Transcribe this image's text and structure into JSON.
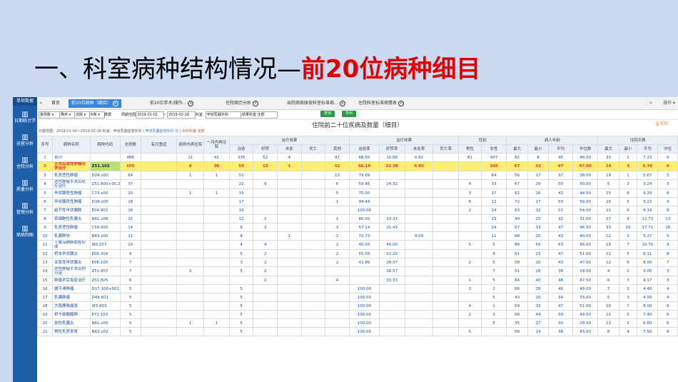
{
  "slide": {
    "title_prefix": "一、科室病种结构情况—",
    "title_highlight": "前20位病种细目"
  },
  "sidebar": {
    "brand": "单项数据",
    "items": [
      {
        "label": "日期统计学"
      },
      {
        "label": "运营分析"
      },
      {
        "label": "住院分析"
      },
      {
        "label": "质量分析"
      },
      {
        "label": "管理分析"
      },
      {
        "label": "病病制图"
      }
    ]
  },
  "tabs": {
    "back_icon": "«",
    "forward_icon": "»",
    "items": [
      {
        "label": "首页",
        "active": false
      },
      {
        "label": "前20位病种（细目）",
        "active": true
      },
      {
        "label": "前20位手术/操作...",
        "active": false
      },
      {
        "label": "住院病历分析",
        "active": false
      },
      {
        "label": "出院病病原按科室标准病...",
        "active": false
      },
      {
        "label": "住院科室标准病情表",
        "active": false
      }
    ],
    "ops": "操作 ▾"
  },
  "toolbar": {
    "sort": "各例数",
    "order": "降序",
    "metric": "出院",
    "rank": "N条",
    "unit": "数据",
    "date_label": "周期范围",
    "date_from": "2019-01-01",
    "date_to": "2019-02-28",
    "dept_label": "科室",
    "dept_value": "甲状乳腺外科",
    "group_value": "结果科室 全部",
    "search_btn": "查询",
    "export_btn": "导出"
  },
  "report": {
    "title": "住院前二十位疾病及数量（细目）",
    "print": "打印",
    "filter_prefix": "日期范围：2019-01-01～2019-02-28 科室：甲状乳腺血管外科 | ",
    "filter_hospital": "甲状乳腺血管外科 日",
    "filter_sep": " | ",
    "filter_group": "出科科室 全部"
  },
  "table": {
    "group_headers": [
      "治疗效果",
      "治疗效果",
      "性别",
      "病人年龄",
      "住院天数"
    ],
    "headers": [
      "序号",
      "病种名称",
      "病种代码",
      "总例数",
      "有月重症",
      "病例内再住院",
      "一月内再住院",
      "治愈",
      "好转",
      "未愈",
      "死亡",
      "其他",
      "治愈率",
      "好转率",
      "未愈率",
      "死亡率",
      "男性",
      "女性",
      "最大",
      "最小",
      "平均",
      "中位数",
      "最大",
      "最小",
      "平均",
      "中位"
    ],
    "rows": [
      [
        "1",
        "合计",
        "",
        "488",
        "",
        "11",
        "41",
        "335",
        "52",
        "4",
        "",
        "97",
        "68.65",
        "10.66",
        "0.82",
        "",
        "81",
        "407",
        "82",
        "8",
        "45",
        "46.00",
        "33",
        "1",
        "7.23",
        "6"
      ],
      [
        "2",
        "手术后恶性肿瘤化学治疗",
        "Z51.102",
        "105",
        "",
        "8",
        "36",
        "59",
        "13",
        "1",
        "",
        "32",
        "56.19",
        "12.38",
        "0.95",
        "",
        "",
        "105",
        "67",
        "32",
        "47",
        "47.00",
        "14",
        "3",
        "6.76",
        "6"
      ],
      [
        "3",
        "乳房恶性肿瘤",
        "D24.x00",
        "64",
        "",
        "1",
        "1",
        "51",
        "",
        "",
        "",
        "13",
        "79.69",
        "",
        "",
        "",
        "",
        "64",
        "56",
        "17",
        "37",
        "38.00",
        "19",
        "1",
        "5.67",
        "5"
      ],
      [
        "4",
        "恶性肿瘤手术后化疗治疗",
        "Z51.800+95.2",
        "37",
        "",
        "",
        "",
        "22",
        "9",
        "",
        "",
        "6",
        "59.46",
        "24.32",
        "",
        "",
        "4",
        "33",
        "67",
        "29",
        "50",
        "50.00",
        "5",
        "2",
        "3.24",
        "3"
      ],
      [
        "5",
        "甲状腺恶性肿瘤",
        "C73.x00",
        "20",
        "",
        "1",
        "1",
        "15",
        "",
        "",
        "",
        "5",
        "75.00",
        "",
        "",
        "",
        "3",
        "17",
        "62",
        "26",
        "43",
        "44.50",
        "15",
        "8",
        "9.20",
        "8"
      ],
      [
        "6",
        "甲状腺良性肿瘤",
        "D34.x00",
        "18",
        "",
        "",
        "",
        "17",
        "",
        "",
        "",
        "1",
        "94.44",
        "",
        "",
        "",
        "6",
        "12",
        "72",
        "17",
        "53",
        "56.00",
        "10",
        "5",
        "9.22",
        "9"
      ],
      [
        "7",
        "结节性甲状腺肿",
        "E04.902",
        "16",
        "",
        "",
        "",
        "16",
        "",
        "",
        "",
        "",
        "100.00",
        "",
        "",
        "",
        "2",
        "14",
        "63",
        "32",
        "51",
        "54.00",
        "11",
        "6",
        "8.19",
        "8"
      ],
      [
        "8",
        "浆细胞性乳腺炎",
        "N61.x06",
        "15",
        "",
        "",
        "",
        "12",
        "2",
        "",
        "",
        "1",
        "80.00",
        "13.33",
        "",
        "",
        "",
        "15",
        "49",
        "25",
        "32",
        "31.00",
        "27",
        "4",
        "12.73",
        "13"
      ],
      [
        "9",
        "乳房恶性肿瘤",
        "C50.900",
        "14",
        "",
        "",
        "",
        "8",
        "3",
        "",
        "",
        "3",
        "57.14",
        "21.43",
        "",
        "",
        "",
        "14",
        "67",
        "33",
        "47",
        "46.50",
        "33",
        "10",
        "17.71",
        "16"
      ],
      [
        "10",
        "乳腺肿块",
        "N63.x00",
        "11",
        "",
        "",
        "",
        "8",
        "",
        "1",
        "",
        "2",
        "72.73",
        "",
        "9.09",
        "",
        "",
        "11",
        "68",
        "20",
        "43",
        "40.00",
        "12",
        "3",
        "5.27",
        "5"
      ],
      [
        "11",
        "下肢深静脉血栓形成",
        "I80.207",
        "10",
        "",
        "",
        "",
        "4",
        "4",
        "",
        "",
        "2",
        "40.00",
        "40.00",
        "",
        "",
        "5",
        "5",
        "88",
        "50",
        "63",
        "66.00",
        "19",
        "7",
        "10.70",
        "9"
      ],
      [
        "12",
        "桥本甲状腺炎",
        "E06.304",
        "9",
        "",
        "",
        "",
        "5",
        "2",
        "",
        "",
        "2",
        "55.56",
        "22.22",
        "",
        "",
        "",
        "9",
        "61",
        "23",
        "47",
        "51.00",
        "11",
        "5",
        "8.11",
        "8"
      ],
      [
        "13",
        "亚急性甲状腺炎",
        "E06.100",
        "7",
        "",
        "",
        "",
        "3",
        "2",
        "",
        "",
        "2",
        "42.86",
        "28.57",
        "",
        "",
        "2",
        "5",
        "58",
        "20",
        "43",
        "47.00",
        "12",
        "6",
        "8.00",
        "7"
      ],
      [
        "14",
        "恶性肿瘤手术后内分泌",
        "Z51.807",
        "7",
        "",
        "2",
        "",
        "5",
        "2",
        "",
        "",
        "",
        "",
        "28.57",
        "",
        "",
        "",
        "7",
        "51",
        "28",
        "38",
        "29.00",
        "4",
        "2",
        "3.00",
        "3"
      ],
      [
        "15",
        "肿瘤术后免疫治疗",
        "Z51.805",
        "6",
        "",
        "",
        "",
        "",
        "2",
        "",
        "",
        "4",
        "",
        "33.33",
        "",
        "",
        "1",
        "5",
        "64",
        "40",
        "48",
        "47.50",
        "6",
        "3",
        "4.17",
        "3"
      ],
      [
        "16",
        "腿平滑肿瘤",
        "D17.100+001",
        "5",
        "",
        "",
        "",
        "5",
        "",
        "",
        "",
        "",
        "100.00",
        "",
        "",
        "",
        "3",
        "2",
        "66",
        "28",
        "46",
        "49.00",
        "7",
        "3",
        "4.40",
        "4"
      ],
      [
        "17",
        "乳腺肿瘤",
        "D48.601",
        "5",
        "",
        "",
        "",
        "5",
        "",
        "",
        "",
        "",
        "100.00",
        "",
        "",
        "",
        "",
        "5",
        "43",
        "20",
        "34",
        "33.00",
        "5",
        "3",
        "4.00",
        "4"
      ],
      [
        "18",
        "大隐静脉曲张",
        "I83.903",
        "5",
        "",
        "",
        "",
        "5",
        "",
        "",
        "",
        "",
        "100.00",
        "",
        "",
        "",
        "4",
        "1",
        "59",
        "33",
        "47",
        "51.00",
        "10",
        "7",
        "8.00",
        "8"
      ],
      [
        "19",
        "桥干细胞腺肿",
        "E72.103",
        "5",
        "",
        "",
        "",
        "5",
        "",
        "",
        "",
        "",
        "100.00",
        "",
        "",
        "",
        "2",
        "3",
        "68",
        "44",
        "50",
        "49.00",
        "11",
        "5",
        "7.40",
        "6"
      ],
      [
        "20",
        "急性乳腺炎",
        "N61.x05",
        "5",
        "",
        "1",
        "1",
        "5",
        "",
        "",
        "",
        "",
        "100.00",
        "",
        "",
        "",
        "",
        "5",
        "35",
        "27",
        "30",
        "29.00",
        "13",
        "3",
        "6.60",
        "6"
      ],
      [
        "21",
        "男性乳房发育",
        "N62.x02",
        "5",
        "",
        "",
        "",
        "5",
        "",
        "",
        "",
        "",
        "100.00",
        "",
        "",
        "",
        "5",
        "",
        "68",
        "14",
        "38",
        "43.00",
        "8",
        "4",
        "7.50",
        "8"
      ]
    ]
  }
}
